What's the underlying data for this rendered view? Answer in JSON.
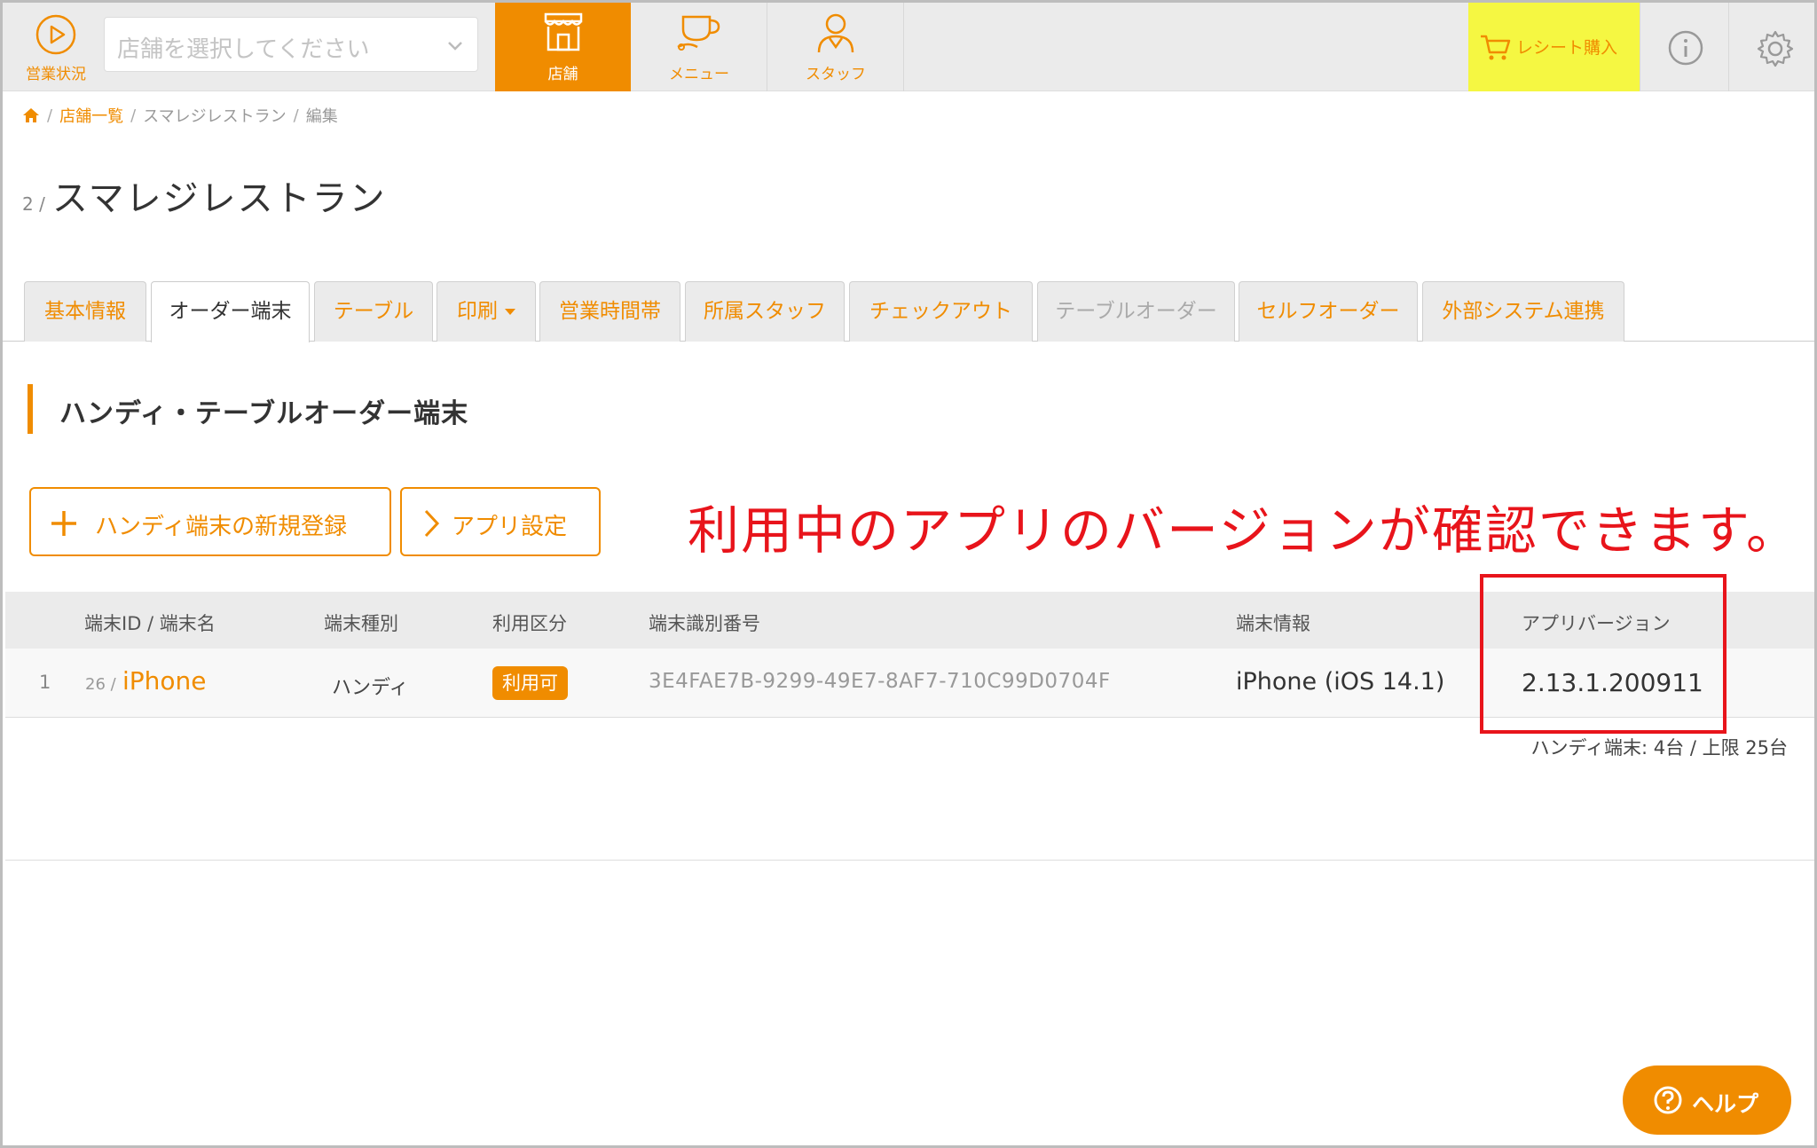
{
  "nav": {
    "status_label": "営業状況",
    "store_select_placeholder": "店舗を選択してください",
    "tabs": [
      {
        "label": "店舗",
        "icon": "store-icon",
        "active": true
      },
      {
        "label": "メニュー",
        "icon": "menu-cup-icon",
        "active": false
      },
      {
        "label": "スタッフ",
        "icon": "staff-icon",
        "active": false
      }
    ],
    "receipt_label": "レシート購入",
    "info_icon": "info-icon",
    "settings_icon": "gear-icon"
  },
  "breadcrumb": {
    "home_icon": "home-icon",
    "items": [
      "店舗一覧",
      "スマレジレストラン",
      "編集"
    ],
    "separator": "/"
  },
  "page": {
    "id_prefix": "2 /",
    "title": "スマレジレストラン"
  },
  "tabs": [
    {
      "label": "基本情報",
      "state": "normal"
    },
    {
      "label": "オーダー端末",
      "state": "active"
    },
    {
      "label": "テーブル",
      "state": "normal"
    },
    {
      "label": "印刷",
      "state": "dropdown"
    },
    {
      "label": "営業時間帯",
      "state": "normal"
    },
    {
      "label": "所属スタッフ",
      "state": "normal"
    },
    {
      "label": "チェックアウト",
      "state": "normal"
    },
    {
      "label": "テーブルオーダー",
      "state": "disabled"
    },
    {
      "label": "セルフオーダー",
      "state": "normal"
    },
    {
      "label": "外部システム連携",
      "state": "normal"
    }
  ],
  "section": {
    "title": "ハンディ・テーブルオーダー端末",
    "add_button": "ハンディ端末の新規登録",
    "app_settings_button": "アプリ設定"
  },
  "annotation": "利用中のアプリのバージョンが確認できます。",
  "table": {
    "headers": [
      "端末ID / 端末名",
      "端末種別",
      "利用区分",
      "端末識別番号",
      "端末情報",
      "アプリバージョン"
    ],
    "rows": [
      {
        "num": "1",
        "id": "26 /",
        "name": "iPhone",
        "type": "ハンディ",
        "status": "利用可",
        "uuid": "3E4FAE7B-9299-49E7-8AF7-710C99D0704F",
        "info": "iPhone (iOS 14.1)",
        "version": "2.13.1.200911"
      }
    ],
    "count_text": "ハンディ端末: 4台 / 上限 25台"
  },
  "help": {
    "label": "ヘルプ"
  },
  "colors": {
    "accent": "#f08c00",
    "annotation": "#e8141b",
    "receipt_bg": "#f5f742"
  }
}
